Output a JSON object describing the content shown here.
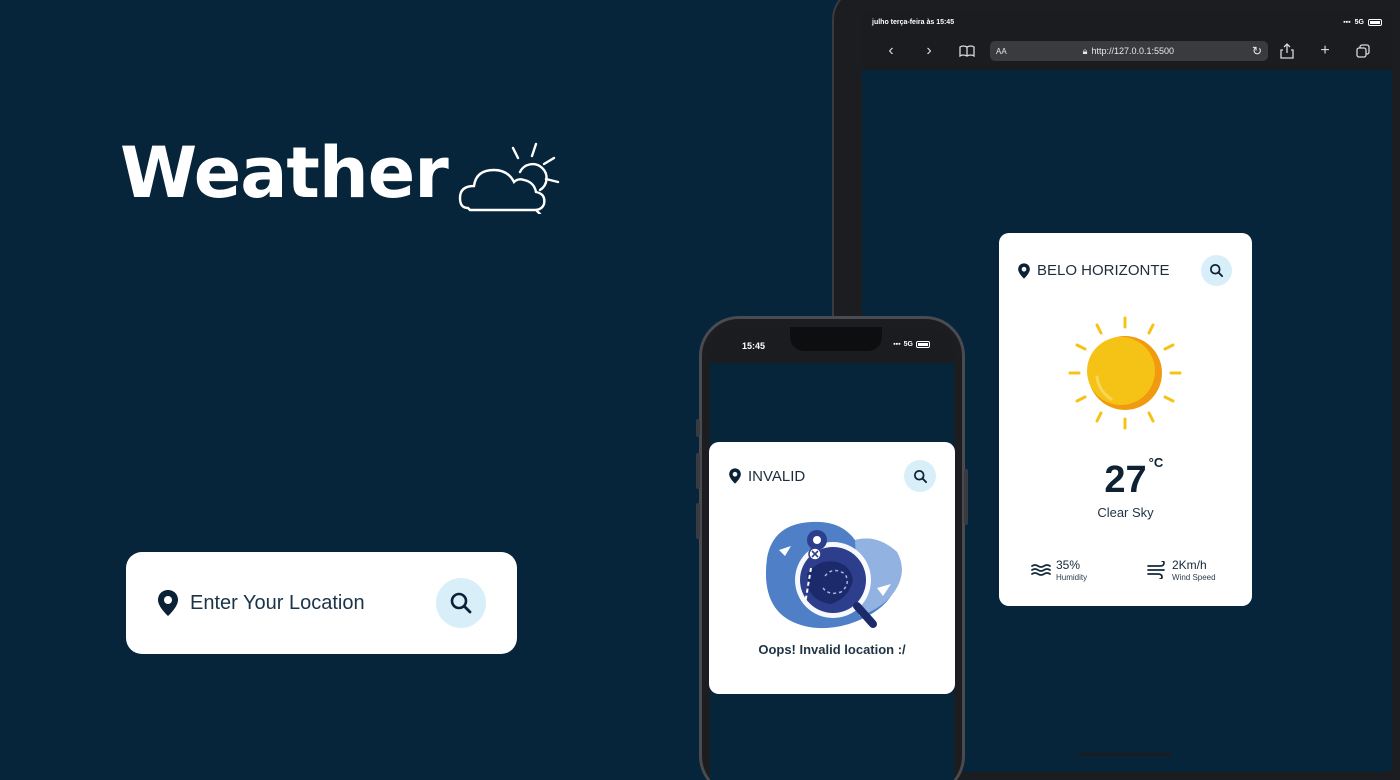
{
  "hero": {
    "title": "Weather",
    "icon": "cloud-sun-icon"
  },
  "search": {
    "placeholder": "Enter Your Location",
    "icon": "search-icon",
    "pin_icon": "location-pin-icon"
  },
  "tablet": {
    "status_left": "julho terça-feira às 15:45",
    "status_right": "5G",
    "browser": {
      "aa": "AA",
      "url": "http://127.0.0.1:5500"
    },
    "card": {
      "city": "BELO HORIZONTE",
      "temperature": "27",
      "unit": "°C",
      "description": "Clear Sky",
      "humidity_value": "35%",
      "humidity_label": "Humidity",
      "wind_value": "2Km/h",
      "wind_label": "Wind Speed"
    }
  },
  "phone": {
    "status_time": "15:45",
    "status_right": "5G",
    "card": {
      "city": "INVALID",
      "message": "Oops! Invalid location :/"
    }
  },
  "colors": {
    "background": "#06253a",
    "card": "#ffffff",
    "search_button": "#d8effa",
    "sun": "#f5c316",
    "sun_shade": "#f29a0f",
    "illustration_blue": "#4f7fc7"
  }
}
